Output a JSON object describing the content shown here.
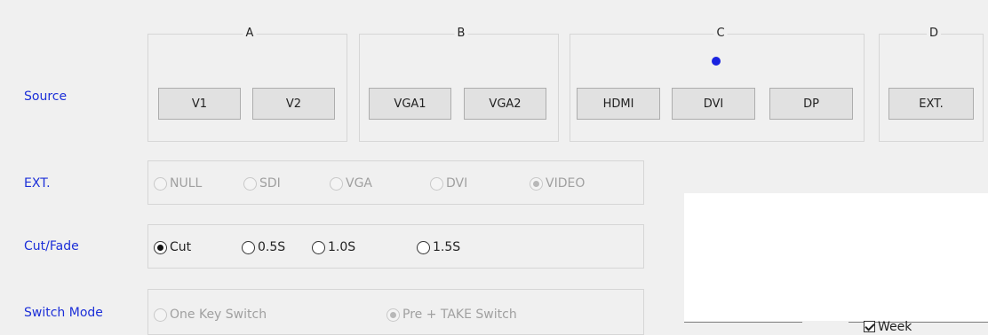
{
  "labels": {
    "source": "Source",
    "ext": "EXT.",
    "cut_fade": "Cut/Fade",
    "switch_mode": "Switch Mode"
  },
  "source_groups": [
    {
      "title": "A",
      "buttons": [
        "V1",
        "V2"
      ]
    },
    {
      "title": "B",
      "buttons": [
        "VGA1",
        "VGA2"
      ]
    },
    {
      "title": "C",
      "buttons": [
        "HDMI",
        "DVI",
        "DP"
      ],
      "active_indicator": true
    },
    {
      "title": "D",
      "buttons": [
        "EXT."
      ]
    }
  ],
  "ext_options": {
    "options": [
      "NULL",
      "SDI",
      "VGA",
      "DVI",
      "VIDEO"
    ],
    "selected": "VIDEO",
    "enabled": false
  },
  "cut_fade_options": {
    "options": [
      "Cut",
      "0.5S",
      "1.0S",
      "1.5S"
    ],
    "selected": "Cut",
    "enabled": true
  },
  "switch_mode_options": {
    "options": [
      "One Key Switch",
      "Pre + TAKE Switch"
    ],
    "selected": "Pre + TAKE Switch",
    "enabled": false
  },
  "week_checkbox": {
    "label": "Week",
    "checked": true
  },
  "colors": {
    "label_blue": "#1c2fd8",
    "indicator_blue": "#1a23e0",
    "background": "#f0f0f0"
  }
}
